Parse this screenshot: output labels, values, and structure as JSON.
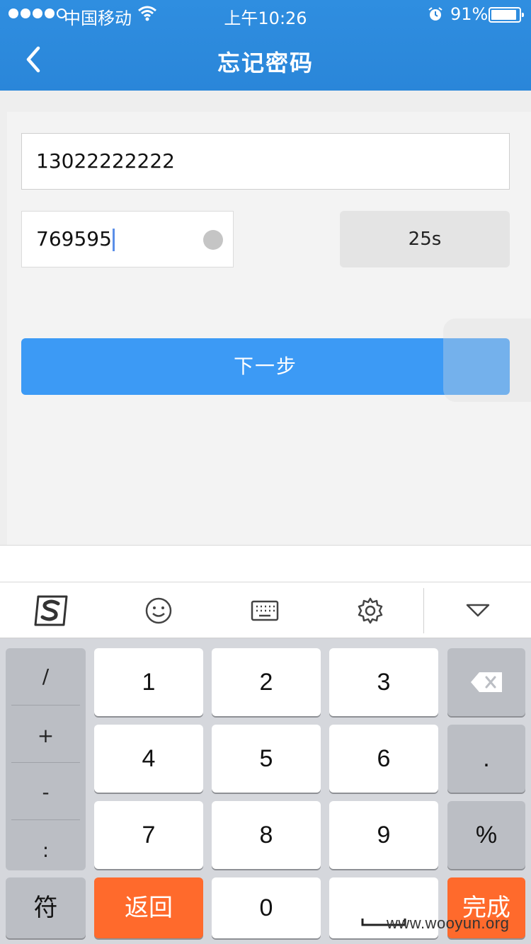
{
  "status_bar": {
    "carrier": "中国移动",
    "time": "上午10:26",
    "battery_percent": "91%",
    "battery_level": 0.91,
    "signal_bars": 4
  },
  "nav": {
    "title": "忘记密码",
    "back_icon": "chevron-left-icon"
  },
  "form": {
    "phone_value": "13022222222",
    "code_value": "769595",
    "countdown_label": "25s",
    "next_label": "下一步"
  },
  "toolbar": {
    "icons": [
      "sogou-logo-icon",
      "emoji-icon",
      "keyboard-icon",
      "gear-icon",
      "collapse-icon"
    ]
  },
  "keyboard": {
    "side_keys": [
      "/",
      "+",
      "-",
      ":"
    ],
    "digits": [
      "1",
      "2",
      "3",
      "4",
      "5",
      "6",
      "7",
      "8",
      "9",
      "0"
    ],
    "dot": ".",
    "percent": "%",
    "symbol_key": "符",
    "back_key": "返回",
    "done_key": "完成"
  },
  "watermark": "www.wooyun.org",
  "colors": {
    "header": "#2a86d9",
    "primary_button": "#3c9af5",
    "orange_key": "#ff6a2c"
  }
}
